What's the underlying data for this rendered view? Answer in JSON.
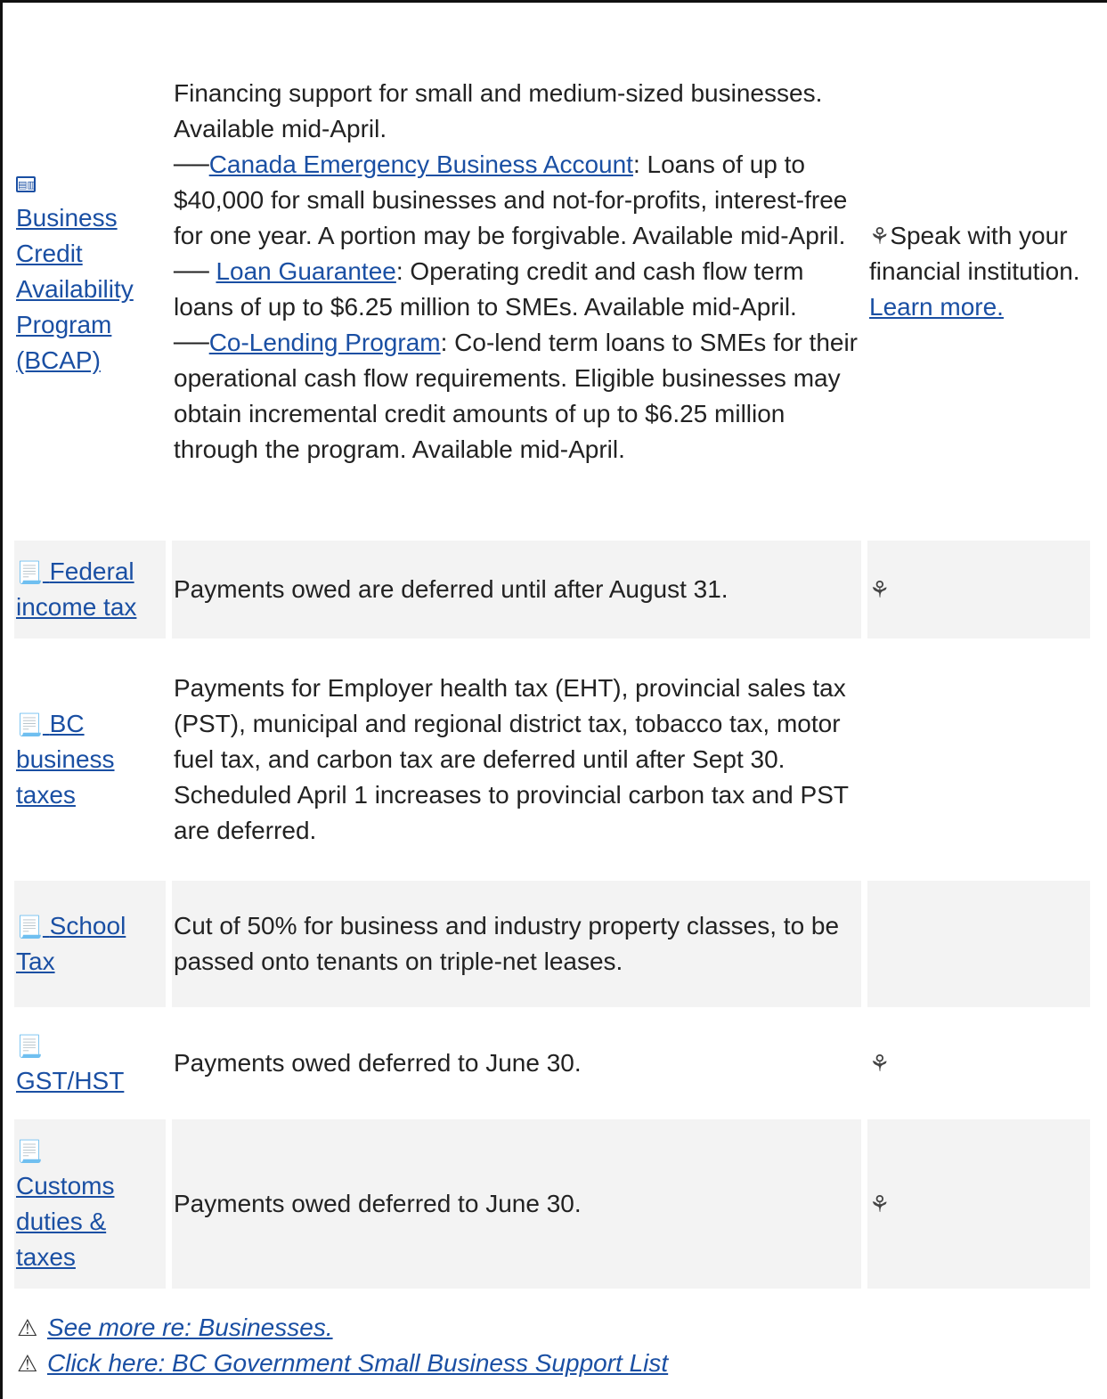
{
  "rows": [
    {
      "icon": "ledger-icon",
      "program": "Business Credit Availability Program (BCAP)",
      "intro": "Financing support for small and medium-sized businesses. Available mid-April.",
      "subitems": [
        {
          "prefix": "──",
          "link": "Canada Emergency Business Account",
          "text": ": Loans of up to $40,000 for small businesses and not-for-profits, interest-free for one year. A portion may be forgivable. Available mid-April."
        },
        {
          "prefix": "── ",
          "link": "Loan Guarantee",
          "text": ": Operating credit and cash flow term loans of up to $6.25 million to SMEs. Available mid-April."
        },
        {
          "prefix": "──",
          "link": "Co-Lending Program",
          "text": ": Co-lend term loans to SMEs for their operational cash flow requirements. Eligible businesses may obtain incremental credit amounts of up to $6.25 million through the program. Available mid-April."
        }
      ],
      "action_text": "Speak with your financial institution.",
      "action_link": "Learn more."
    },
    {
      "icon": "receipt-icon",
      "program": "Federal income tax",
      "detail": "Payments owed are deferred until after August 31.",
      "federal": true
    },
    {
      "icon": "receipt-icon",
      "program": "BC business taxes",
      "detail": "Payments for Employer health tax (EHT), provincial sales tax (PST), municipal and regional district tax, tobacco tax, motor fuel tax, and carbon tax are deferred until after Sept 30. Scheduled April 1 increases to provincial carbon tax and PST are deferred.",
      "federal": false
    },
    {
      "icon": "receipt-icon",
      "program": "School Tax",
      "detail": "Cut of 50% for business and industry property classes, to be passed onto tenants on triple-net leases.",
      "federal": false
    },
    {
      "icon": "receipt-icon",
      "program": "GST/HST",
      "detail": "Payments owed deferred to June 30.",
      "federal": true
    },
    {
      "icon": "receipt-icon",
      "program": "Customs duties & taxes",
      "detail": "Payments owed deferred to June 30.",
      "federal": true
    }
  ],
  "footer_links": [
    {
      "icon": "warning-icon",
      "label": "See more re: Businesses."
    },
    {
      "icon": "warning-icon",
      "label": "Click here: BC Government Small Business Support List"
    }
  ],
  "glyphs": {
    "maple": "⚘",
    "receipt": "📃",
    "warning": "⚠",
    "ledger": "▤▥"
  }
}
